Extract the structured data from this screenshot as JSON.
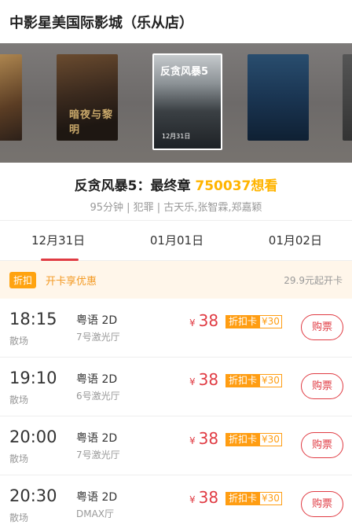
{
  "cinema": {
    "title": "中影星美国际影城（乐从店）"
  },
  "posters": [
    {
      "name": "poster-1",
      "text": ""
    },
    {
      "name": "poster-2",
      "text": "暗夜与黎明"
    },
    {
      "name": "poster-3-selected",
      "title": "反贪风暴5",
      "date": "12月31日"
    },
    {
      "name": "poster-4",
      "text": ""
    }
  ],
  "film": {
    "name": "反贪风暴5：最终章",
    "want": "750037想看",
    "meta": "95分钟 | 犯罪 | 古天乐,张智霖,郑嘉颖"
  },
  "tabs": [
    {
      "label": "12月31日",
      "active": true
    },
    {
      "label": "01月01日",
      "active": false
    },
    {
      "label": "01月02日",
      "active": false
    }
  ],
  "promo": {
    "badge": "折扣",
    "text": "开卡享优惠",
    "right": "29.9元起开卡"
  },
  "showtimes": [
    {
      "time": "18:15",
      "type": "散场",
      "lang": "粤语 2D",
      "hall": "7号激光厅",
      "yen": "¥",
      "price": "38",
      "card_label": "折扣卡",
      "card_price": "¥30",
      "buy": "购票"
    },
    {
      "time": "19:10",
      "type": "散场",
      "lang": "粤语 2D",
      "hall": "6号激光厅",
      "yen": "¥",
      "price": "38",
      "card_label": "折扣卡",
      "card_price": "¥30",
      "buy": "购票"
    },
    {
      "time": "20:00",
      "type": "散场",
      "lang": "粤语 2D",
      "hall": "7号激光厅",
      "yen": "¥",
      "price": "38",
      "card_label": "折扣卡",
      "card_price": "¥30",
      "buy": "购票"
    },
    {
      "time": "20:30",
      "type": "散场",
      "lang": "粤语 2D",
      "hall": "DMAX厅",
      "yen": "¥",
      "price": "38",
      "card_label": "折扣卡",
      "card_price": "¥30",
      "buy": "购票"
    }
  ],
  "colors": {
    "accent": "#e03b43",
    "want": "#ffb400",
    "card": "#ff9d12",
    "promo_bg": "#fff6ea"
  }
}
